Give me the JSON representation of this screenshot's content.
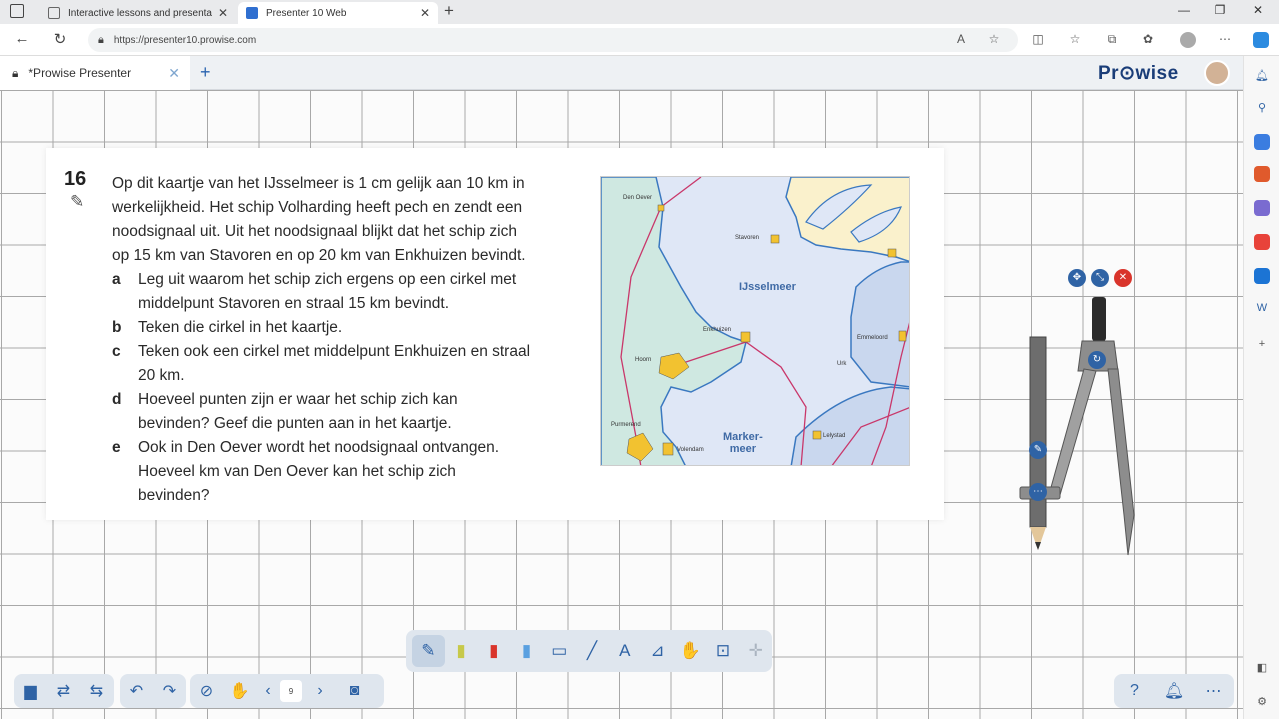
{
  "browser": {
    "tabs": [
      {
        "title": "Interactive lessons and presentat",
        "active": false
      },
      {
        "title": "Presenter 10 Web",
        "active": true
      }
    ],
    "url": "https://presenter10.prowise.com"
  },
  "app": {
    "tab_title": "*Prowise Presenter",
    "logo": "Pr⊙wise"
  },
  "exercise": {
    "number": "16",
    "intro": [
      "Op dit kaartje van het IJsselmeer is 1 cm gelijk aan 10 km in",
      "werkelijkheid. Het schip Volharding heeft pech en zendt een",
      "noodsignaal uit. Uit het noodsignaal blijkt dat het schip zich",
      "op 15 km van Stavoren en op 20 km van Enkhuizen bevindt."
    ],
    "parts": [
      {
        "letter": "a",
        "lines": [
          "Leg uit waarom het schip zich ergens op een cirkel met",
          "middelpunt Stavoren en straal 15 km bevindt."
        ]
      },
      {
        "letter": "b",
        "lines": [
          "Teken die cirkel in het kaartje."
        ]
      },
      {
        "letter": "c",
        "lines": [
          "Teken ook een cirkel met middelpunt Enkhuizen en straal",
          "20 km."
        ]
      },
      {
        "letter": "d",
        "lines": [
          "Hoeveel punten zijn er waar het schip zich kan",
          "bevinden? Geef die punten aan in het kaartje."
        ]
      },
      {
        "letter": "e",
        "lines": [
          "Ook in Den Oever wordt het noodsignaal ontvangen.",
          "Hoeveel km van Den Oever kan het schip zich",
          "bevinden?"
        ]
      }
    ]
  },
  "map": {
    "places": {
      "den_oever": "Den Oever",
      "stavoren": "Stavoren",
      "enkhuizen": "Enkhuizen",
      "hoorn": "Hoorn",
      "purmerend": "Purmerend",
      "volendam": "Volendam",
      "emmeloord": "Emmeloord",
      "urk": "Urk",
      "lelystad": "Lelystad"
    },
    "ijsselmeer": "IJsselmeer",
    "markermeer_1": "Marker-",
    "markermeer_2": "meer"
  },
  "toolbar": {
    "page_number": "9"
  },
  "colors": {
    "accent": "#2f63a5",
    "close_red": "#d9342b",
    "water": "#dfe7f6",
    "land_green": "#cfe8e1",
    "land_yellow": "#faf1cc"
  }
}
